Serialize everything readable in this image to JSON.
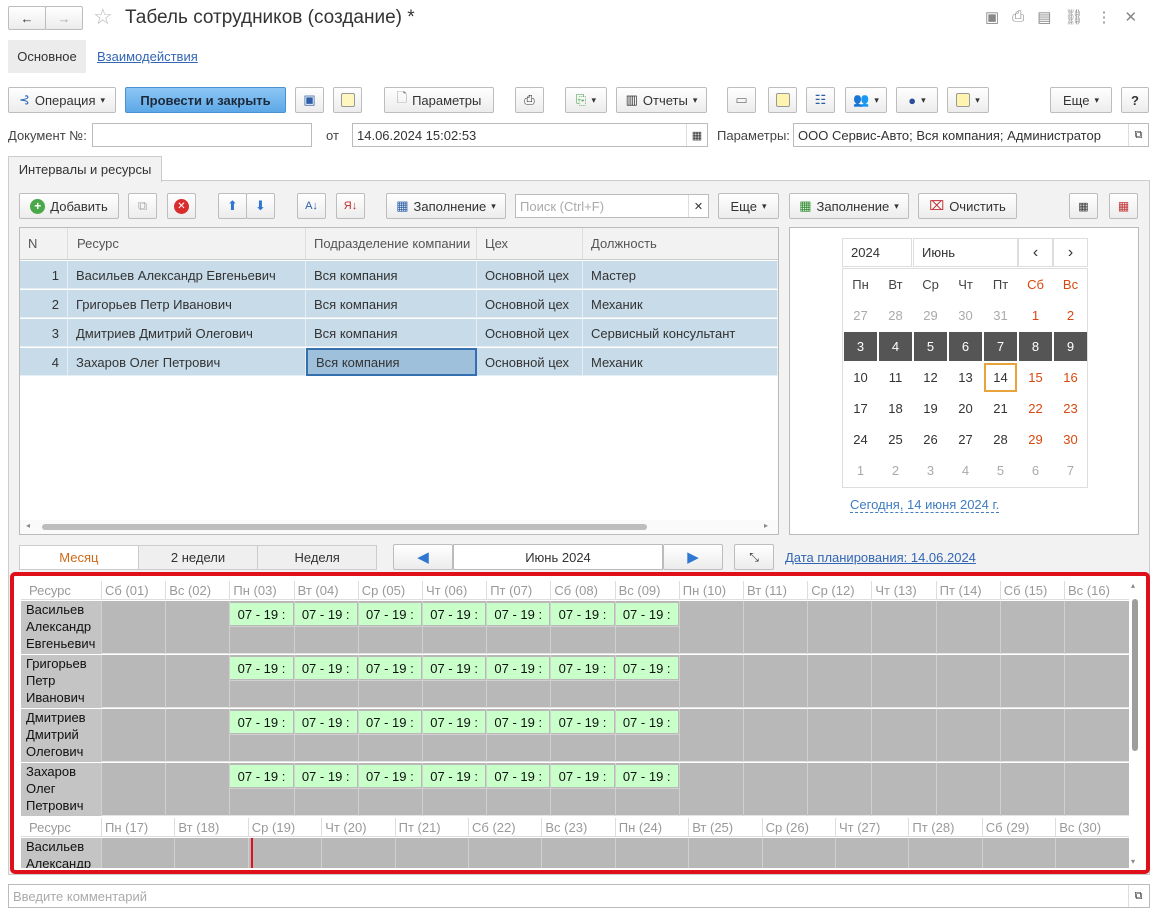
{
  "window": {
    "title": "Табель сотрудников (создание) *",
    "nav_back": "←",
    "nav_forward": "→"
  },
  "tabs_top": {
    "main": "Основное",
    "interactions": "Взаимодействия"
  },
  "toolbar": {
    "operation": "Операция",
    "post_close": "Провести и закрыть",
    "params": "Параметры",
    "reports": "Отчеты",
    "more": "Еще",
    "help": "?"
  },
  "header": {
    "doc_label": "Документ №:",
    "doc_value": "",
    "from_label": "от",
    "date_value": "14.06.2024 15:02:53",
    "params_label": "Параметры:",
    "params_value": "ООО Сервис-Авто; Вся компания; Администратор"
  },
  "section_tab": "Интервалы и ресурсы",
  "table_toolbar": {
    "add": "Добавить",
    "fill": "Заполнение",
    "search_placeholder": "Поиск (Ctrl+F)",
    "more": "Еще",
    "fill2": "Заполнение",
    "clear": "Очистить"
  },
  "table": {
    "columns": [
      "N",
      "Ресурс",
      "Подразделение компании",
      "Цех",
      "Должность"
    ],
    "rows": [
      [
        "1",
        "Васильев Александр Евгеньевич",
        "Вся компания",
        "Основной цех",
        "Мастер"
      ],
      [
        "2",
        "Григорьев Петр Иванович",
        "Вся компания",
        "Основной цех",
        "Механик"
      ],
      [
        "3",
        "Дмитриев Дмитрий Олегович",
        "Вся компания",
        "Основной цех",
        "Сервисный консультант"
      ],
      [
        "4",
        "Захаров Олег Петрович",
        "Вся компания",
        "Основной цех",
        "Механик"
      ]
    ]
  },
  "calendar": {
    "year": "2024",
    "month": "Июнь",
    "prev": "‹",
    "next": "›",
    "weekdays": [
      "Пн",
      "Вт",
      "Ср",
      "Чт",
      "Пт",
      "Сб",
      "Вс"
    ],
    "weeks": [
      [
        "27",
        "28",
        "29",
        "30",
        "31",
        "1",
        "2"
      ],
      [
        "3",
        "4",
        "5",
        "6",
        "7",
        "8",
        "9"
      ],
      [
        "10",
        "11",
        "12",
        "13",
        "14",
        "15",
        "16"
      ],
      [
        "17",
        "18",
        "19",
        "20",
        "21",
        "22",
        "23"
      ],
      [
        "24",
        "25",
        "26",
        "27",
        "28",
        "29",
        "30"
      ],
      [
        "1",
        "2",
        "3",
        "4",
        "5",
        "6",
        "7"
      ]
    ],
    "today_link": "Сегодня, 14 июня 2024 г.",
    "weekend_color": "#d9480f",
    "selected_color": "#555555",
    "today_border": "#e8a33a"
  },
  "period": {
    "month": "Месяц",
    "two_weeks": "2 недели",
    "week": "Неделя",
    "current": "Июнь 2024",
    "planning_date": "Дата планирования: 14.06.2024"
  },
  "schedule": {
    "resource_label": "Ресурс",
    "days_1": [
      "Сб (01)",
      "Вс (02)",
      "Пн (03)",
      "Вт (04)",
      "Ср (05)",
      "Чт (06)",
      "Пт (07)",
      "Сб (08)",
      "Вс (09)",
      "Пн (10)",
      "Вт (11)",
      "Ср (12)",
      "Чт (13)",
      "Пт (14)",
      "Сб (15)",
      "Вс (16)"
    ],
    "days_2": [
      "Пн (17)",
      "Вт (18)",
      "Ср (19)",
      "Чт (20)",
      "Пт (21)",
      "Сб (22)",
      "Вс (23)",
      "Пн (24)",
      "Вт (25)",
      "Ср (26)",
      "Чт (27)",
      "Пт (28)",
      "Сб (29)",
      "Вс (30)"
    ],
    "resources": [
      [
        "Васильев",
        "Александр",
        "Евгеньевич"
      ],
      [
        "Григорьев",
        "Петр",
        "Иванович"
      ],
      [
        "Дмитриев",
        "Дмитрий",
        "Олегович"
      ],
      [
        "Захаров",
        "Олег",
        "Петрович"
      ]
    ],
    "shift": "07 - 19 :",
    "resource_2": [
      "Васильев",
      "Александр"
    ],
    "shift_color": "#c9ffc9",
    "highlight_color": "#e0101a"
  },
  "comment_placeholder": "Введите комментарий"
}
